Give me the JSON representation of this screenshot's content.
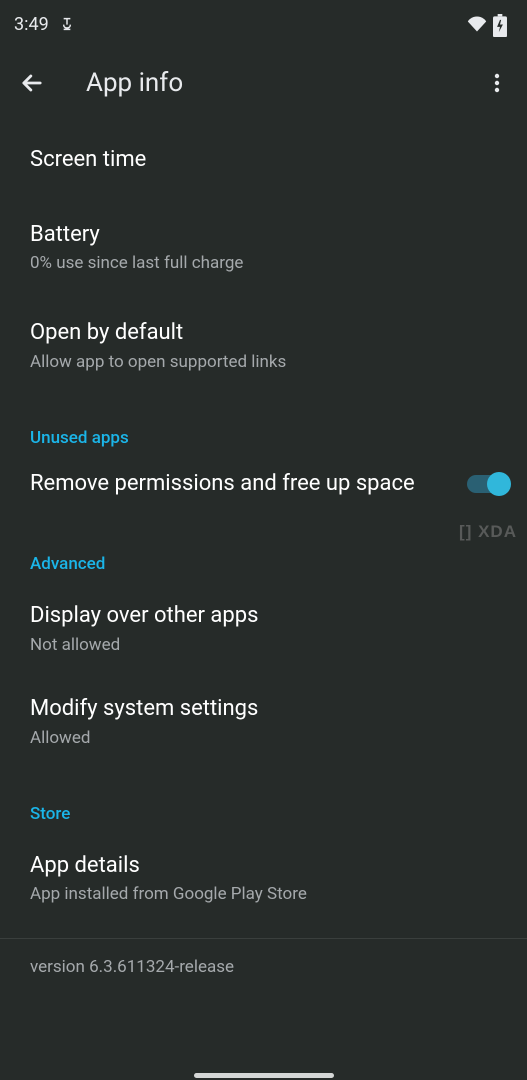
{
  "status": {
    "time": "3:49"
  },
  "header": {
    "title": "App info"
  },
  "rows": {
    "screen_time": {
      "title": "Screen time"
    },
    "battery": {
      "title": "Battery",
      "subtitle": "0% use since last full charge"
    },
    "open_by_default": {
      "title": "Open by default",
      "subtitle": "Allow app to open supported links"
    },
    "remove_permissions": {
      "title": "Remove permissions and free up space"
    },
    "display_over": {
      "title": "Display over other apps",
      "subtitle": "Not allowed"
    },
    "modify_system": {
      "title": "Modify system settings",
      "subtitle": "Allowed"
    },
    "app_details": {
      "title": "App details",
      "subtitle": "App installed from Google Play Store"
    }
  },
  "sections": {
    "unused_apps": "Unused apps",
    "advanced": "Advanced",
    "store": "Store"
  },
  "version": "version 6.3.611324-release",
  "watermark": "[] XDA"
}
